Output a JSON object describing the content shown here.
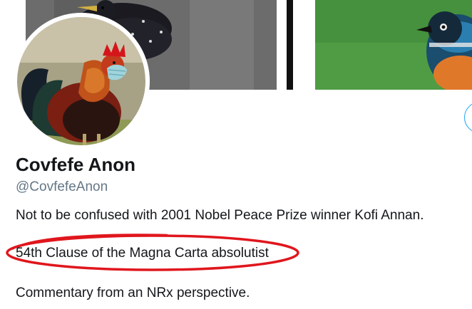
{
  "profile": {
    "display_name": "Covfefe Anon",
    "handle": "@CovfefeAnon"
  },
  "bio": {
    "line1": "Not to be confused with 2001 Nobel Peace Prize winner Kofi Annan.",
    "line2": "54th Clause of the Magna Carta absolutist",
    "line3": "Commentary from an NRx perspective."
  },
  "colors": {
    "text": "#14171a",
    "secondary_text": "#657786",
    "accent": "#1da1f2",
    "annotation": "#e0161d"
  }
}
